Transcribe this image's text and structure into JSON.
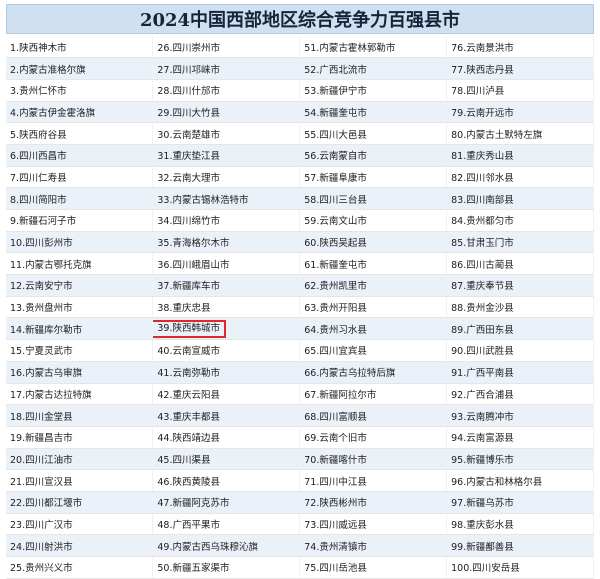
{
  "title": "2024中国西部地区综合竞争力百强县市",
  "highlight_rank": 39,
  "columns": [
    [
      "1.陕西神木市",
      "2.内蒙古准格尔旗",
      "3.贵州仁怀市",
      "4.内蒙古伊金霍洛旗",
      "5.陕西府谷县",
      "6.四川西昌市",
      "7.四川仁寿县",
      "8.四川简阳市",
      "9.新疆石河子市",
      "10.四川彭州市",
      "11.内蒙古鄂托克旗",
      "12.云南安宁市",
      "13.贵州盘州市",
      "14.新疆库尔勒市",
      "15.宁夏灵武市",
      "16.内蒙古乌审旗",
      "17.内蒙古达拉特旗",
      "18.四川金堂县",
      "19.新疆昌吉市",
      "20.四川江油市",
      "21.四川宣汉县",
      "22.四川都江堰市",
      "23.四川广汉市",
      "24.四川射洪市",
      "25.贵州兴义市"
    ],
    [
      "26.四川崇州市",
      "27.四川邛崃市",
      "28.四川什邡市",
      "29.四川大竹县",
      "30.云南楚雄市",
      "31.重庆垫江县",
      "32.云南大理市",
      "33.内蒙古锡林浩特市",
      "34.四川绵竹市",
      "35.青海格尔木市",
      "36.四川峨眉山市",
      "37.新疆库车市",
      "38.重庆忠县",
      "39.陕西韩城市",
      "40.云南宣威市",
      "41.云南弥勒市",
      "42.重庆云阳县",
      "43.重庆丰都县",
      "44.陕西靖边县",
      "45.四川渠县",
      "46.陕西黄陵县",
      "47.新疆阿克苏市",
      "48.广西平果市",
      "49.内蒙古西乌珠穆沁旗",
      "50.新疆五家渠市"
    ],
    [
      "51.内蒙古霍林郭勒市",
      "52.广西北流市",
      "53.新疆伊宁市",
      "54.新疆奎屯市",
      "55.四川大邑县",
      "56.云南蒙自市",
      "57.新疆阜康市",
      "58.四川三台县",
      "59.云南文山市",
      "60.陕西吴起县",
      "61.新疆奎屯市",
      "62.贵州凯里市",
      "63.贵州开阳县",
      "64.贵州习水县",
      "65.四川宜宾县",
      "66.内蒙古乌拉特后旗",
      "67.新疆阿拉尔市",
      "68.四川富顺县",
      "69.云南个旧市",
      "70.新疆喀什市",
      "71.四川中江县",
      "72.陕西彬州市",
      "73.四川威远县",
      "74.贵州清镇市",
      "75.四川岳池县"
    ],
    [
      "76.云南景洪市",
      "77.陕西志丹县",
      "78.四川泸县",
      "79.云南开远市",
      "80.内蒙古土默特左旗",
      "81.重庆秀山县",
      "82.四川邻水县",
      "83.四川南部县",
      "84.贵州都匀市",
      "85.甘肃玉门市",
      "86.四川古蔺县",
      "87.重庆奉节县",
      "88.贵州金沙县",
      "89.广西田东县",
      "90.四川武胜县",
      "91.广西平南县",
      "92.广西合浦县",
      "93.云南腾冲市",
      "94.云南富源县",
      "95.新疆博乐市",
      "96.内蒙古和林格尔县",
      "97.新疆乌苏市",
      "98.重庆彭水县",
      "99.新疆鄯善县",
      "100.四川安岳县"
    ]
  ]
}
